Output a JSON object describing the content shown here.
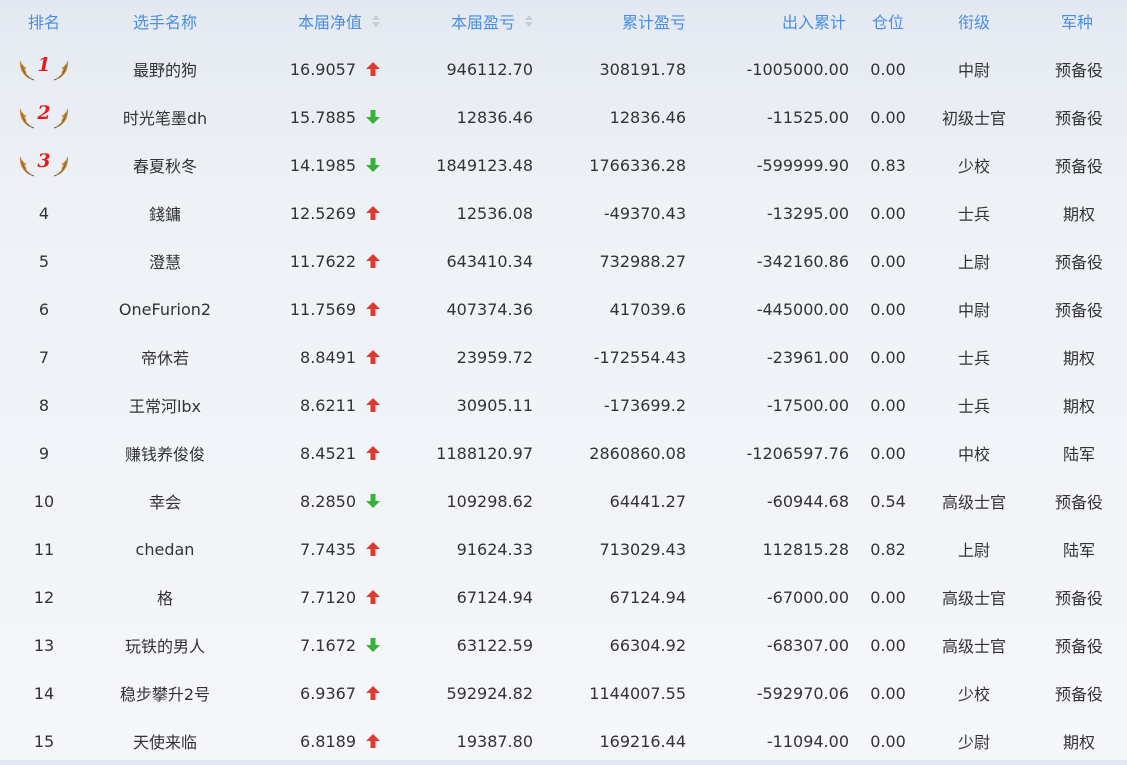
{
  "colors": {
    "header_text": "#4a8fe0",
    "up_arrow": "#e03a2c",
    "down_arrow": "#36b23a",
    "medal_wing": "#c48c3c",
    "medal_number": "#e02020"
  },
  "header": {
    "rank": "排名",
    "player": "选手名称",
    "nav": "本届净值",
    "season_pl": "本届盈亏",
    "total_pl": "累计盈亏",
    "inout": "出入累计",
    "position": "仓位",
    "grade": "衔级",
    "branch": "军种"
  },
  "rows": [
    {
      "rank": "1",
      "medal": "wing-medal-icon",
      "name": "最野的狗",
      "nav": "16.9057",
      "trend": "up",
      "season_pl": "946112.70",
      "total_pl": "308191.78",
      "inout": "-1005000.00",
      "position": "0.00",
      "grade": "中尉",
      "branch": "预备役"
    },
    {
      "rank": "2",
      "medal": "wing-medal-icon",
      "name": "时光笔墨dh",
      "nav": "15.7885",
      "trend": "down",
      "season_pl": "12836.46",
      "total_pl": "12836.46",
      "inout": "-11525.00",
      "position": "0.00",
      "grade": "初级士官",
      "branch": "预备役"
    },
    {
      "rank": "3",
      "medal": "wing-medal-icon",
      "name": "春夏秋冬",
      "nav": "14.1985",
      "trend": "down",
      "season_pl": "1849123.48",
      "total_pl": "1766336.28",
      "inout": "-599999.90",
      "position": "0.83",
      "grade": "少校",
      "branch": "预备役"
    },
    {
      "rank": "4",
      "name": "錢鏞",
      "nav": "12.5269",
      "trend": "up",
      "season_pl": "12536.08",
      "total_pl": "-49370.43",
      "inout": "-13295.00",
      "position": "0.00",
      "grade": "士兵",
      "branch": "期权"
    },
    {
      "rank": "5",
      "name": "澄慧",
      "nav": "11.7622",
      "trend": "up",
      "season_pl": "643410.34",
      "total_pl": "732988.27",
      "inout": "-342160.86",
      "position": "0.00",
      "grade": "上尉",
      "branch": "预备役"
    },
    {
      "rank": "6",
      "name": "OneFurion2",
      "nav": "11.7569",
      "trend": "up",
      "season_pl": "407374.36",
      "total_pl": "417039.6",
      "inout": "-445000.00",
      "position": "0.00",
      "grade": "中尉",
      "branch": "预备役"
    },
    {
      "rank": "7",
      "name": "帝休若",
      "nav": "8.8491",
      "trend": "up",
      "season_pl": "23959.72",
      "total_pl": "-172554.43",
      "inout": "-23961.00",
      "position": "0.00",
      "grade": "士兵",
      "branch": "期权"
    },
    {
      "rank": "8",
      "name": "王常河lbx",
      "nav": "8.6211",
      "trend": "up",
      "season_pl": "30905.11",
      "total_pl": "-173699.2",
      "inout": "-17500.00",
      "position": "0.00",
      "grade": "士兵",
      "branch": "期权"
    },
    {
      "rank": "9",
      "name": "赚钱养俊俊",
      "nav": "8.4521",
      "trend": "up",
      "season_pl": "1188120.97",
      "total_pl": "2860860.08",
      "inout": "-1206597.76",
      "position": "0.00",
      "grade": "中校",
      "branch": "陆军"
    },
    {
      "rank": "10",
      "name": "幸会",
      "nav": "8.2850",
      "trend": "down",
      "season_pl": "109298.62",
      "total_pl": "64441.27",
      "inout": "-60944.68",
      "position": "0.54",
      "grade": "高级士官",
      "branch": "预备役"
    },
    {
      "rank": "11",
      "name": "chedan",
      "nav": "7.7435",
      "trend": "up",
      "season_pl": "91624.33",
      "total_pl": "713029.43",
      "inout": "112815.28",
      "position": "0.82",
      "grade": "上尉",
      "branch": "陆军"
    },
    {
      "rank": "12",
      "name": "格",
      "nav": "7.7120",
      "trend": "up",
      "season_pl": "67124.94",
      "total_pl": "67124.94",
      "inout": "-67000.00",
      "position": "0.00",
      "grade": "高级士官",
      "branch": "预备役"
    },
    {
      "rank": "13",
      "name": "玩铁的男人",
      "nav": "7.1672",
      "trend": "down",
      "season_pl": "63122.59",
      "total_pl": "66304.92",
      "inout": "-68307.00",
      "position": "0.00",
      "grade": "高级士官",
      "branch": "预备役"
    },
    {
      "rank": "14",
      "name": "稳步攀升2号",
      "nav": "6.9367",
      "trend": "up",
      "season_pl": "592924.82",
      "total_pl": "1144007.55",
      "inout": "-592970.06",
      "position": "0.00",
      "grade": "少校",
      "branch": "预备役"
    },
    {
      "rank": "15",
      "name": "天使来临",
      "nav": "6.8189",
      "trend": "up",
      "season_pl": "19387.80",
      "total_pl": "169216.44",
      "inout": "-11094.00",
      "position": "0.00",
      "grade": "少尉",
      "branch": "期权"
    }
  ]
}
